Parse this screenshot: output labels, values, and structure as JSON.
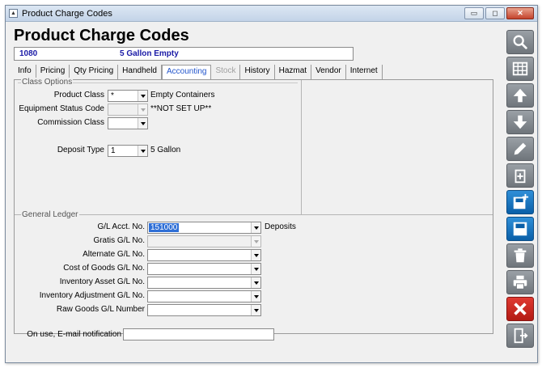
{
  "window": {
    "title": "Product Charge Codes"
  },
  "page": {
    "title": "Product Charge Codes"
  },
  "record": {
    "code": "1080",
    "description": "5 Gallon Empty"
  },
  "tabs": [
    {
      "label": "Info"
    },
    {
      "label": "Pricing"
    },
    {
      "label": "Qty Pricing"
    },
    {
      "label": "Handheld"
    },
    {
      "label": "Accounting"
    },
    {
      "label": "Stock"
    },
    {
      "label": "History"
    },
    {
      "label": "Hazmat"
    },
    {
      "label": "Vendor"
    },
    {
      "label": "Internet"
    }
  ],
  "class_options": {
    "caption": "Class Options",
    "product_class": {
      "label": "Product Class",
      "value": "*",
      "description": "Empty Containers"
    },
    "equipment_status_code": {
      "label": "Equipment Status Code",
      "value": "",
      "description": "**NOT SET UP**"
    },
    "commission_class": {
      "label": "Commission Class",
      "value": ""
    },
    "deposit_type": {
      "label": "Deposit Type",
      "value": "1",
      "description": "5 Gallon"
    }
  },
  "general_ledger": {
    "caption": "General Ledger",
    "gl_acct": {
      "label": "G/L Acct. No.",
      "value": "151000",
      "description": "Deposits"
    },
    "gratis": {
      "label": "Gratis G/L No.",
      "value": ""
    },
    "alternate": {
      "label": "Alternate G/L No.",
      "value": ""
    },
    "cogs": {
      "label": "Cost of Goods G/L No.",
      "value": ""
    },
    "inv_asset": {
      "label": "Inventory Asset G/L No.",
      "value": ""
    },
    "inv_adjust": {
      "label": "Inventory Adjustment G/L No.",
      "value": ""
    },
    "raw_goods": {
      "label": "Raw Goods G/L Number",
      "value": ""
    }
  },
  "notification": {
    "label": "On use, E-mail notification",
    "value": ""
  },
  "toolbar": [
    {
      "icon": "search-icon"
    },
    {
      "icon": "grid-icon"
    },
    {
      "icon": "arrow-up-icon"
    },
    {
      "icon": "arrow-down-icon"
    },
    {
      "icon": "edit-icon"
    },
    {
      "icon": "copy-icon"
    },
    {
      "icon": "save-new-icon"
    },
    {
      "icon": "save-icon"
    },
    {
      "icon": "trash-icon"
    },
    {
      "icon": "print-icon"
    },
    {
      "icon": "close-icon"
    },
    {
      "icon": "exit-icon"
    }
  ]
}
